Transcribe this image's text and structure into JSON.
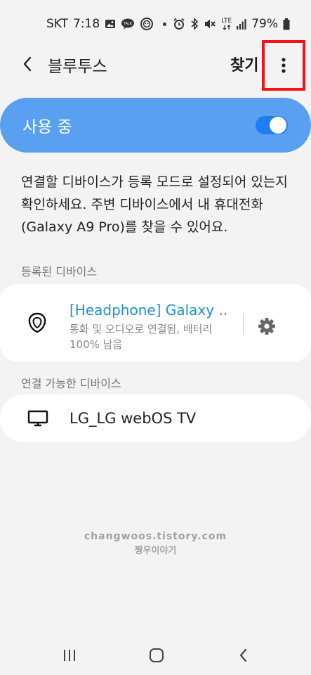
{
  "status_bar": {
    "carrier": "SKT",
    "time": "7:18",
    "network": "LTE",
    "battery": "79%",
    "icons": [
      "image-icon",
      "talk-icon",
      "face-icon",
      "dot-icon",
      "alarm-icon",
      "bluetooth-icon",
      "mute-icon",
      "lte-icon",
      "signal-icon",
      "battery-icon"
    ]
  },
  "toolbar": {
    "title": "블루투스",
    "find_label": "찾기",
    "back_icon": "chevron-left-icon",
    "more_icon": "more-vert-icon"
  },
  "master_toggle": {
    "label": "사용 중",
    "on": true
  },
  "description": "연결할 디바이스가 등록 모드로 설정되어 있는지 확인하세요. 주변 디바이스에서 내 휴대전화(Galaxy A9 Pro)를 찾을 수 있어요.",
  "paired_section": {
    "header": "등록된 디바이스",
    "devices": [
      {
        "name": "[Headphone] Galaxy ..",
        "status": "통화 및 오디오로 연결됨, 배터리 100% 남음",
        "icon": "earbud-icon"
      }
    ]
  },
  "available_section": {
    "header": "연결 가능한 디바이스",
    "devices": [
      {
        "name": "LG_LG webOS TV",
        "icon": "tv-icon"
      }
    ]
  },
  "watermark": {
    "line1": "changwoos.tistory.com",
    "line2": "짱우이야기"
  },
  "colors": {
    "accent": "#5aa0f0",
    "switch": "#1f7df2",
    "connected_text": "#1a94c9",
    "highlight": "#f21314",
    "background": "#f3f3f3"
  }
}
